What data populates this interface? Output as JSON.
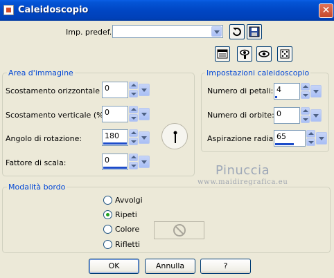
{
  "window": {
    "title": "Caleidoscopio",
    "close_symbol": "✕"
  },
  "preset": {
    "label": "Imp. predef.:",
    "value": ""
  },
  "image_area": {
    "title": "Area d'immagine",
    "fields": [
      {
        "label": "Scostamento orizzontale (%):",
        "value": "0",
        "fill": 0.0
      },
      {
        "label": "Scostamento verticale (%):",
        "value": "0",
        "fill": 0.0
      },
      {
        "label": "Angolo di rotazione:",
        "value": "180",
        "fill": 1.0
      },
      {
        "label": "Fattore di scala:",
        "value": "0",
        "fill": 1.0
      }
    ]
  },
  "kaleido_settings": {
    "title": "Impostazioni caleidoscopio",
    "fields": [
      {
        "label": "Numero di petali:",
        "value": "4",
        "fill": 0.1
      },
      {
        "label": "Numero di orbite:",
        "value": "0",
        "fill": 0.0
      },
      {
        "label": "Aspirazione radiale:",
        "value": "65",
        "fill": 0.65
      }
    ]
  },
  "edge_mode": {
    "title": "Modalità bordo",
    "options": [
      {
        "label": "Avvolgi",
        "checked": false
      },
      {
        "label": "Ripeti",
        "checked": true
      },
      {
        "label": "Colore",
        "checked": false
      },
      {
        "label": "Rifletti",
        "checked": false
      }
    ]
  },
  "watermark": {
    "line1": "Pinuccia",
    "line2": "www.maidiregrafica.eu"
  },
  "buttons": {
    "ok": "OK",
    "cancel": "Annulla",
    "help": "?"
  }
}
